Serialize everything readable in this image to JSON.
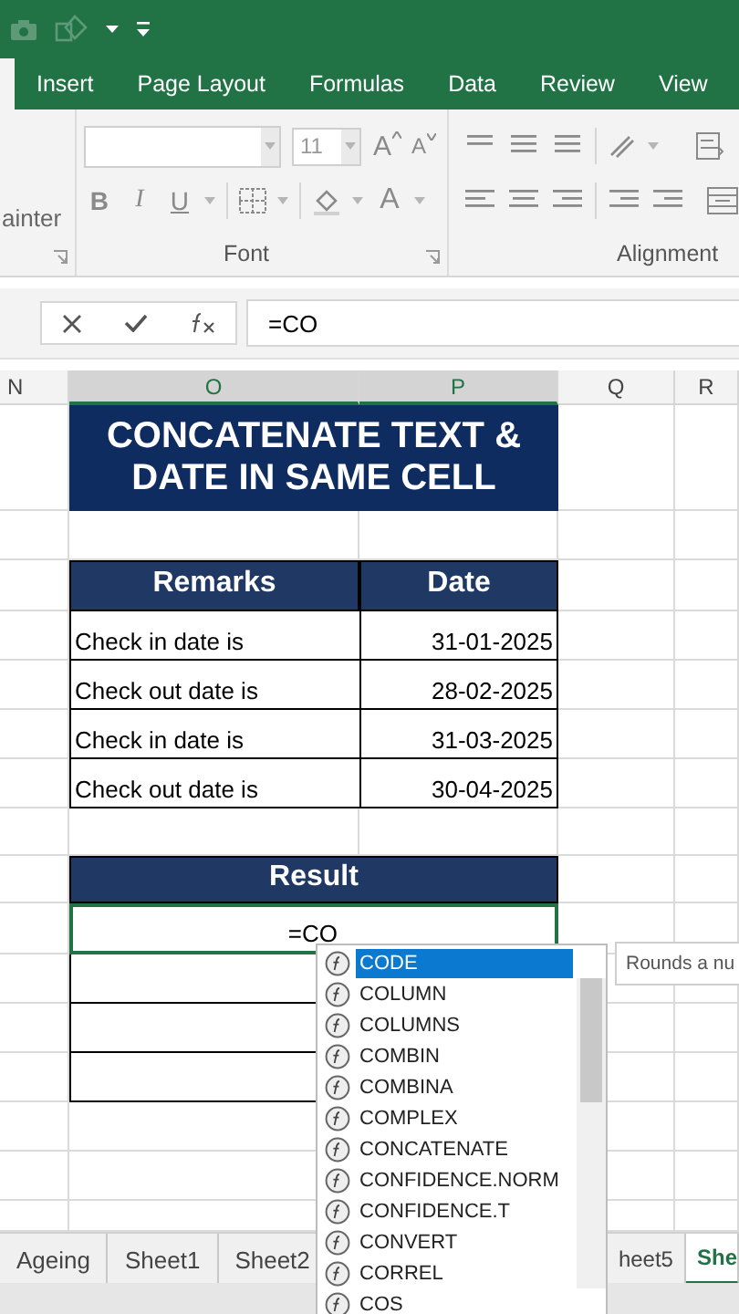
{
  "ribbon_tabs": [
    {
      "label": "Insert",
      "selected": false
    },
    {
      "label": "Page Layout",
      "selected": false
    },
    {
      "label": "Formulas",
      "selected": false
    },
    {
      "label": "Data",
      "selected": false
    },
    {
      "label": "Review",
      "selected": false
    },
    {
      "label": "View",
      "selected": false
    }
  ],
  "ribbon": {
    "clipboard_text": "ainter",
    "font_size": "11",
    "format_buttons": [
      "B",
      "I",
      "U"
    ],
    "grow_font": "A",
    "shrink_font": "A",
    "font_color": "A",
    "groups": [
      "Font",
      "Alignment"
    ]
  },
  "formula_bar": {
    "value": "=CO"
  },
  "columns": [
    {
      "label": "N",
      "selected": false
    },
    {
      "label": "O",
      "selected": true
    },
    {
      "label": "P",
      "selected": true
    },
    {
      "label": "Q",
      "selected": false
    },
    {
      "label": "R",
      "selected": false
    }
  ],
  "sheet": {
    "title_lines": [
      "CONCATENATE TEXT &",
      "DATE IN SAME CELL"
    ],
    "headers": [
      "Remarks",
      "Date"
    ],
    "rows": [
      {
        "remark": "Check in date is",
        "date": "31-01-2025"
      },
      {
        "remark": "Check out date is",
        "date": "28-02-2025"
      },
      {
        "remark": "Check in date is",
        "date": "31-03-2025"
      },
      {
        "remark": "Check out date is",
        "date": "30-04-2025"
      }
    ],
    "result_header": "Result",
    "active_cell": "=CO"
  },
  "autocomplete": {
    "items": [
      {
        "label": "CODE",
        "selected": true
      },
      {
        "label": "COLUMN",
        "selected": false
      },
      {
        "label": "COLUMNS",
        "selected": false
      },
      {
        "label": "COMBIN",
        "selected": false
      },
      {
        "label": "COMBINA",
        "selected": false
      },
      {
        "label": "COMPLEX",
        "selected": false
      },
      {
        "label": "CONCATENATE",
        "selected": false
      },
      {
        "label": "CONFIDENCE.NORM",
        "selected": false
      },
      {
        "label": "CONFIDENCE.T",
        "selected": false
      },
      {
        "label": "CONVERT",
        "selected": false
      },
      {
        "label": "CORREL",
        "selected": false
      },
      {
        "label": "COS",
        "selected": false
      }
    ],
    "tooltip": "Rounds a nu"
  },
  "sheet_tabs": [
    {
      "label": "Ageing",
      "selected": false
    },
    {
      "label": "Sheet1",
      "selected": false
    },
    {
      "label": "Sheet2",
      "selected": false
    },
    {
      "label": "heet5",
      "selected": false
    },
    {
      "label": "She",
      "selected": true
    }
  ]
}
